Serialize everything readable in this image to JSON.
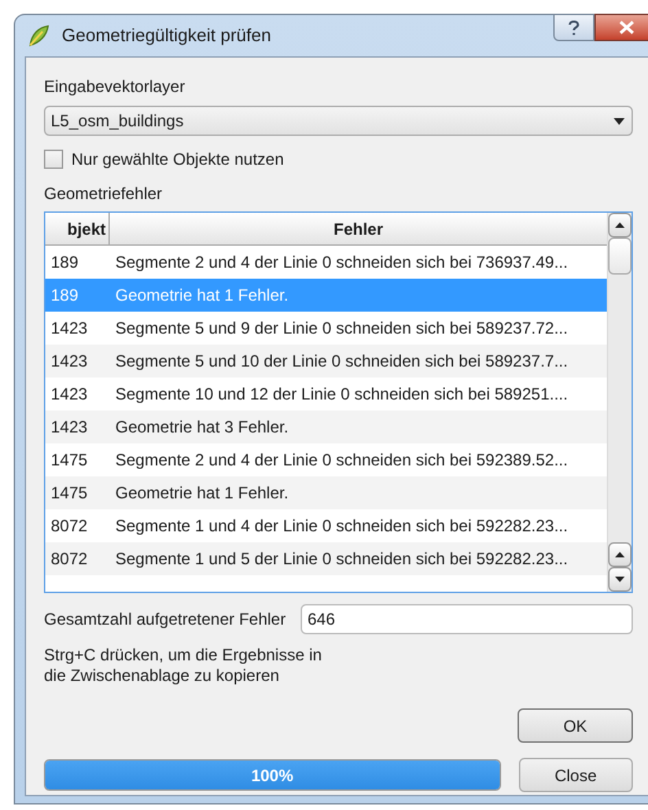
{
  "window": {
    "title": "Geometriegültigkeit prüfen"
  },
  "input_layer": {
    "label": "Eingabevektorlayer",
    "value": "L5_osm_buildings"
  },
  "selected_only": {
    "label": "Nur gewählte Objekte nutzen",
    "checked": false
  },
  "errors": {
    "label": "Geometriefehler",
    "columns": [
      "bjekt",
      "Fehler"
    ],
    "rows": [
      {
        "object": "189",
        "error": "Segmente 2 und 4 der Linie 0 schneiden sich bei 736937.49...",
        "selected": false
      },
      {
        "object": "189",
        "error": "Geometrie hat 1 Fehler.",
        "selected": true
      },
      {
        "object": "1423",
        "error": "Segmente 5 und 9 der Linie 0 schneiden sich bei 589237.72...",
        "selected": false
      },
      {
        "object": "1423",
        "error": "Segmente 5 und 10 der Linie 0 schneiden sich bei 589237.7...",
        "selected": false
      },
      {
        "object": "1423",
        "error": "Segmente 10 und 12 der Linie 0 schneiden sich bei 589251....",
        "selected": false
      },
      {
        "object": "1423",
        "error": "Geometrie hat 3 Fehler.",
        "selected": false
      },
      {
        "object": "1475",
        "error": "Segmente 2 und 4 der Linie 0 schneiden sich bei 592389.52...",
        "selected": false
      },
      {
        "object": "1475",
        "error": "Geometrie hat 1 Fehler.",
        "selected": false
      },
      {
        "object": "8072",
        "error": "Segmente 1 und 4 der Linie 0 schneiden sich bei 592282.23...",
        "selected": false
      },
      {
        "object": "8072",
        "error": "Segmente 1 und 5 der Linie 0 schneiden sich bei 592282.23...",
        "selected": false
      }
    ]
  },
  "total": {
    "label": "Gesamtzahl aufgetretener Fehler",
    "value": "646"
  },
  "hint": "Strg+C drücken, um die Ergebnisse in die Zwischenablage zu kopieren",
  "buttons": [
    "OK",
    "Close"
  ],
  "progress": {
    "level": 1,
    "reading": "100%"
  }
}
